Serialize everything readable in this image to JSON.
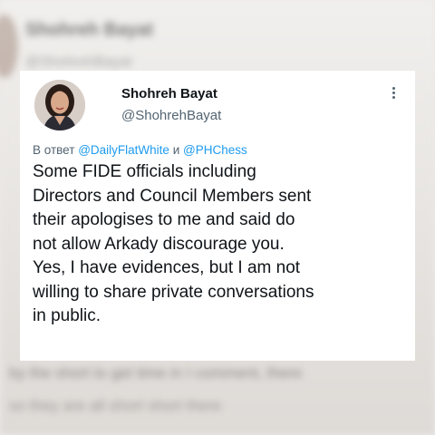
{
  "tweet": {
    "author_name": "Shohreh Bayat",
    "author_handle": "@ShohrehBayat",
    "reply_prefix": "В ответ",
    "reply_mention_1": "@DailyFlatWhite",
    "reply_conjunction": "и",
    "reply_mention_2": "@PHChess",
    "text_lines": [
      "Some FIDE officials including",
      "Directors and Council Members sent",
      "their apologises to me and said do",
      "not allow Arkady discourage you.",
      "Yes, I have evidences, but I am not",
      "willing to share private conversations",
      "in public."
    ],
    "more_icon": "more-vertical-icon"
  },
  "backdrop": {
    "name_blur": "Shohreh Bayat",
    "handle_blur": "@ShohrehBayat",
    "bottom_line_1": "by the short to get time in I comment, there",
    "bottom_line_2": "so they are all short short there"
  },
  "colors": {
    "link": "#1d9bf0",
    "secondary_text": "#536471",
    "primary_text": "#0f1419"
  }
}
